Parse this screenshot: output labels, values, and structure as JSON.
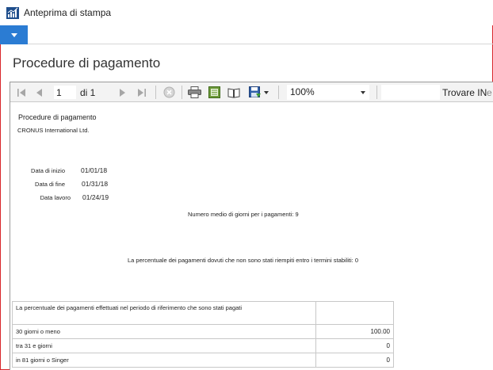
{
  "window": {
    "title": "Anteprima di stampa"
  },
  "page": {
    "heading": "Procedure di pagamento"
  },
  "toolbar": {
    "page_current": "1",
    "page_of": "di 1",
    "zoom": "100%",
    "find_label": "Trovare IN",
    "next_label": "e"
  },
  "report": {
    "title": "Procedure di pagamento",
    "company": "CRONUS International Ltd.",
    "fields": [
      {
        "label": "Data di inizio",
        "value": "01/01/18"
      },
      {
        "label": "Data di fine",
        "value": "01/31/18"
      },
      {
        "label": "Data lavoro",
        "value": "01/24/19"
      }
    ],
    "avg_days": "Numero medio di giorni per i pagamenti: 9",
    "overdue_pct": "La percentuale dei pagamenti dovuti che non sono stati riempiti entro i termini stabiliti: 0",
    "table": {
      "header": "La percentuale dei pagamenti effettuati nel periodo di riferimento che sono stati pagati",
      "rows": [
        {
          "label": "30 giorni o meno",
          "value": "100.00"
        },
        {
          "label": "tra 31 e giorni",
          "value": "0"
        },
        {
          "label": "in 81 giorni o Singer",
          "value": "0"
        }
      ]
    }
  },
  "colors": {
    "accent": "#2b7cd3",
    "window_border": "#d9262b"
  }
}
